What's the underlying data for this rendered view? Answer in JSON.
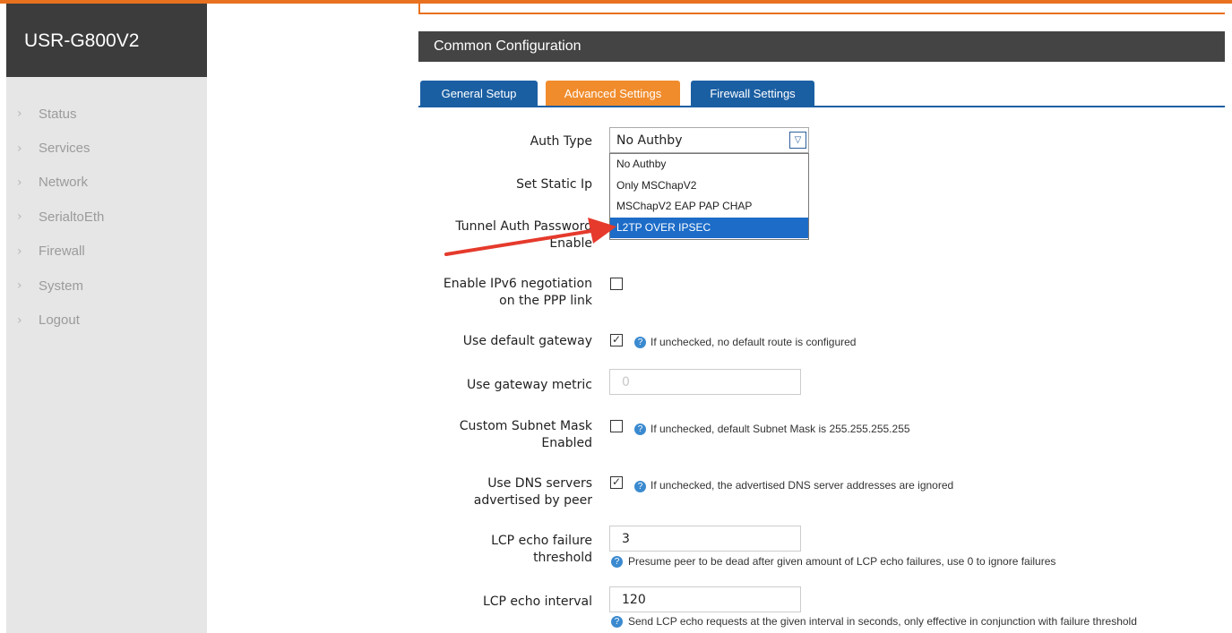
{
  "brand": "USR-G800V2",
  "nav": [
    "Status",
    "Services",
    "Network",
    "SerialtoEth",
    "Firewall",
    "System",
    "Logout"
  ],
  "section_title": "Common Configuration",
  "tabs": {
    "general": "General Setup",
    "advanced": "Advanced Settings",
    "firewall": "Firewall Settings"
  },
  "accent": {
    "orange": "#f08c2c",
    "blue": "#1b5fa3",
    "header": "#444444",
    "selection": "#1c6cc8"
  },
  "form": {
    "auth_type": {
      "label": "Auth Type",
      "value": "No Authby"
    },
    "auth_options": [
      "No Authby",
      "Only MSChapV2",
      "MSChapV2 EAP PAP CHAP",
      "L2TP OVER IPSEC"
    ],
    "static_ip_label": "Set Static Ip",
    "tunnel_auth": {
      "label_line1": "Tunnel Auth Password",
      "label_line2": "Enable"
    },
    "ipv6": {
      "label_line1": "Enable IPv6 negotiation",
      "label_line2": "on the PPP link"
    },
    "default_gw": {
      "label": "Use default gateway",
      "help": "If unchecked, no default route is configured"
    },
    "gw_metric": {
      "label": "Use gateway metric",
      "value": "0"
    },
    "subnet": {
      "label_line1": "Custom Subnet Mask",
      "label_line2": "Enabled",
      "help": "If unchecked, default Subnet Mask is 255.255.255.255"
    },
    "dns": {
      "label_line1": "Use DNS servers",
      "label_line2": "advertised by peer",
      "help": "If unchecked, the advertised DNS server addresses are ignored"
    },
    "lcp_fail": {
      "label_line1": "LCP echo failure",
      "label_line2": "threshold",
      "value": "3",
      "help": "Presume peer to be dead after given amount of LCP echo failures, use 0 to ignore failures"
    },
    "lcp_interval": {
      "label": "LCP echo interval",
      "value": "120",
      "help": "Send LCP echo requests at the given interval in seconds, only effective in conjunction with failure threshold"
    }
  },
  "icons": {
    "nav_chevron": "chevron-right-icon",
    "help": "help-icon",
    "select_arrow": "chevron-down-icon",
    "annotation": "red-arrow"
  }
}
